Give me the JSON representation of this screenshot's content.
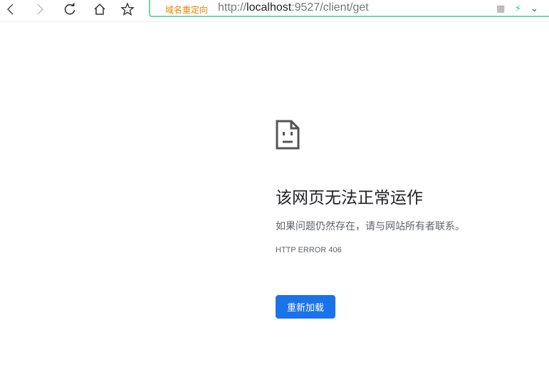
{
  "toolbar": {
    "redirect_label": "域名重定向",
    "url_prefix": "http://",
    "url_host": "localhost",
    "url_rest": ":9527/client/get"
  },
  "error": {
    "title": "该网页无法正常运作",
    "message": "如果问题仍然存在，请与网站所有者联系。",
    "code": "HTTP ERROR 406",
    "reload_label": "重新加载"
  },
  "colors": {
    "accent": "#1a73e8",
    "address_border": "#6fd9a5",
    "redirect": "#f08000"
  }
}
